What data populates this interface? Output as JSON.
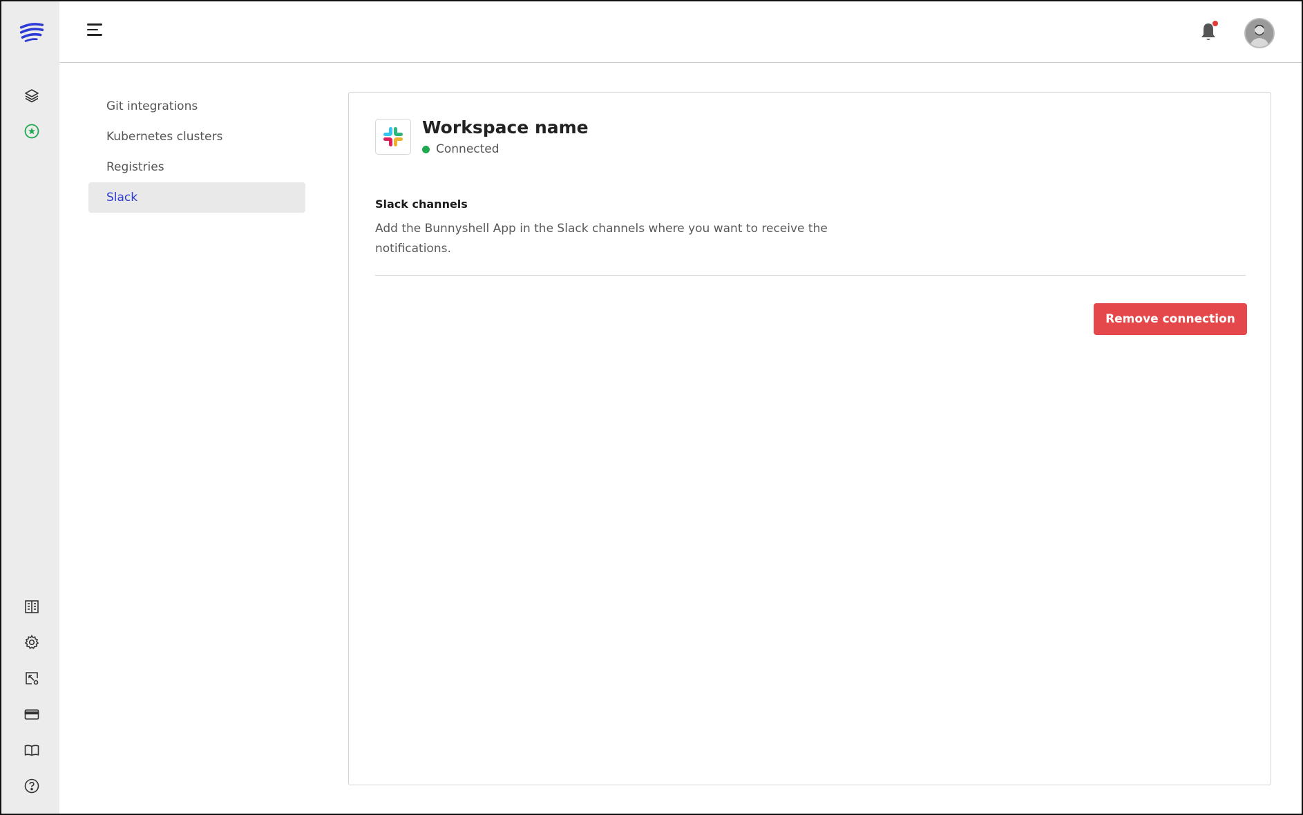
{
  "app": {
    "logo_icon": "bunnyshell-logo-icon",
    "accent_color": "#2c3ad6"
  },
  "rail": {
    "top_items": [
      {
        "icon": "layers-icon"
      },
      {
        "icon": "star-circle-icon",
        "color": "#1fa84f"
      }
    ],
    "bottom_items": [
      {
        "icon": "building-icon"
      },
      {
        "icon": "gear-icon"
      },
      {
        "icon": "cursor-window-icon"
      },
      {
        "icon": "credit-card-icon"
      },
      {
        "icon": "book-icon"
      },
      {
        "icon": "help-icon"
      }
    ]
  },
  "topbar": {
    "menu_icon": "hamburger-icon",
    "notification_icon": "bell-icon",
    "notification_dot_color": "#e53935"
  },
  "settings_nav": {
    "items": [
      {
        "label": "Git integrations",
        "active": false
      },
      {
        "label": "Kubernetes clusters",
        "active": false
      },
      {
        "label": "Registries",
        "active": false
      },
      {
        "label": "Slack",
        "active": true
      }
    ]
  },
  "slack_card": {
    "workspace_name": "Workspace name",
    "status": "Connected",
    "status_color": "#1fa84f",
    "section_title": "Slack channels",
    "section_description": "Add the Bunnyshell App in the Slack channels where you want to receive the notifications.",
    "remove_button_label": "Remove connection",
    "remove_button_color": "#e5484a"
  }
}
